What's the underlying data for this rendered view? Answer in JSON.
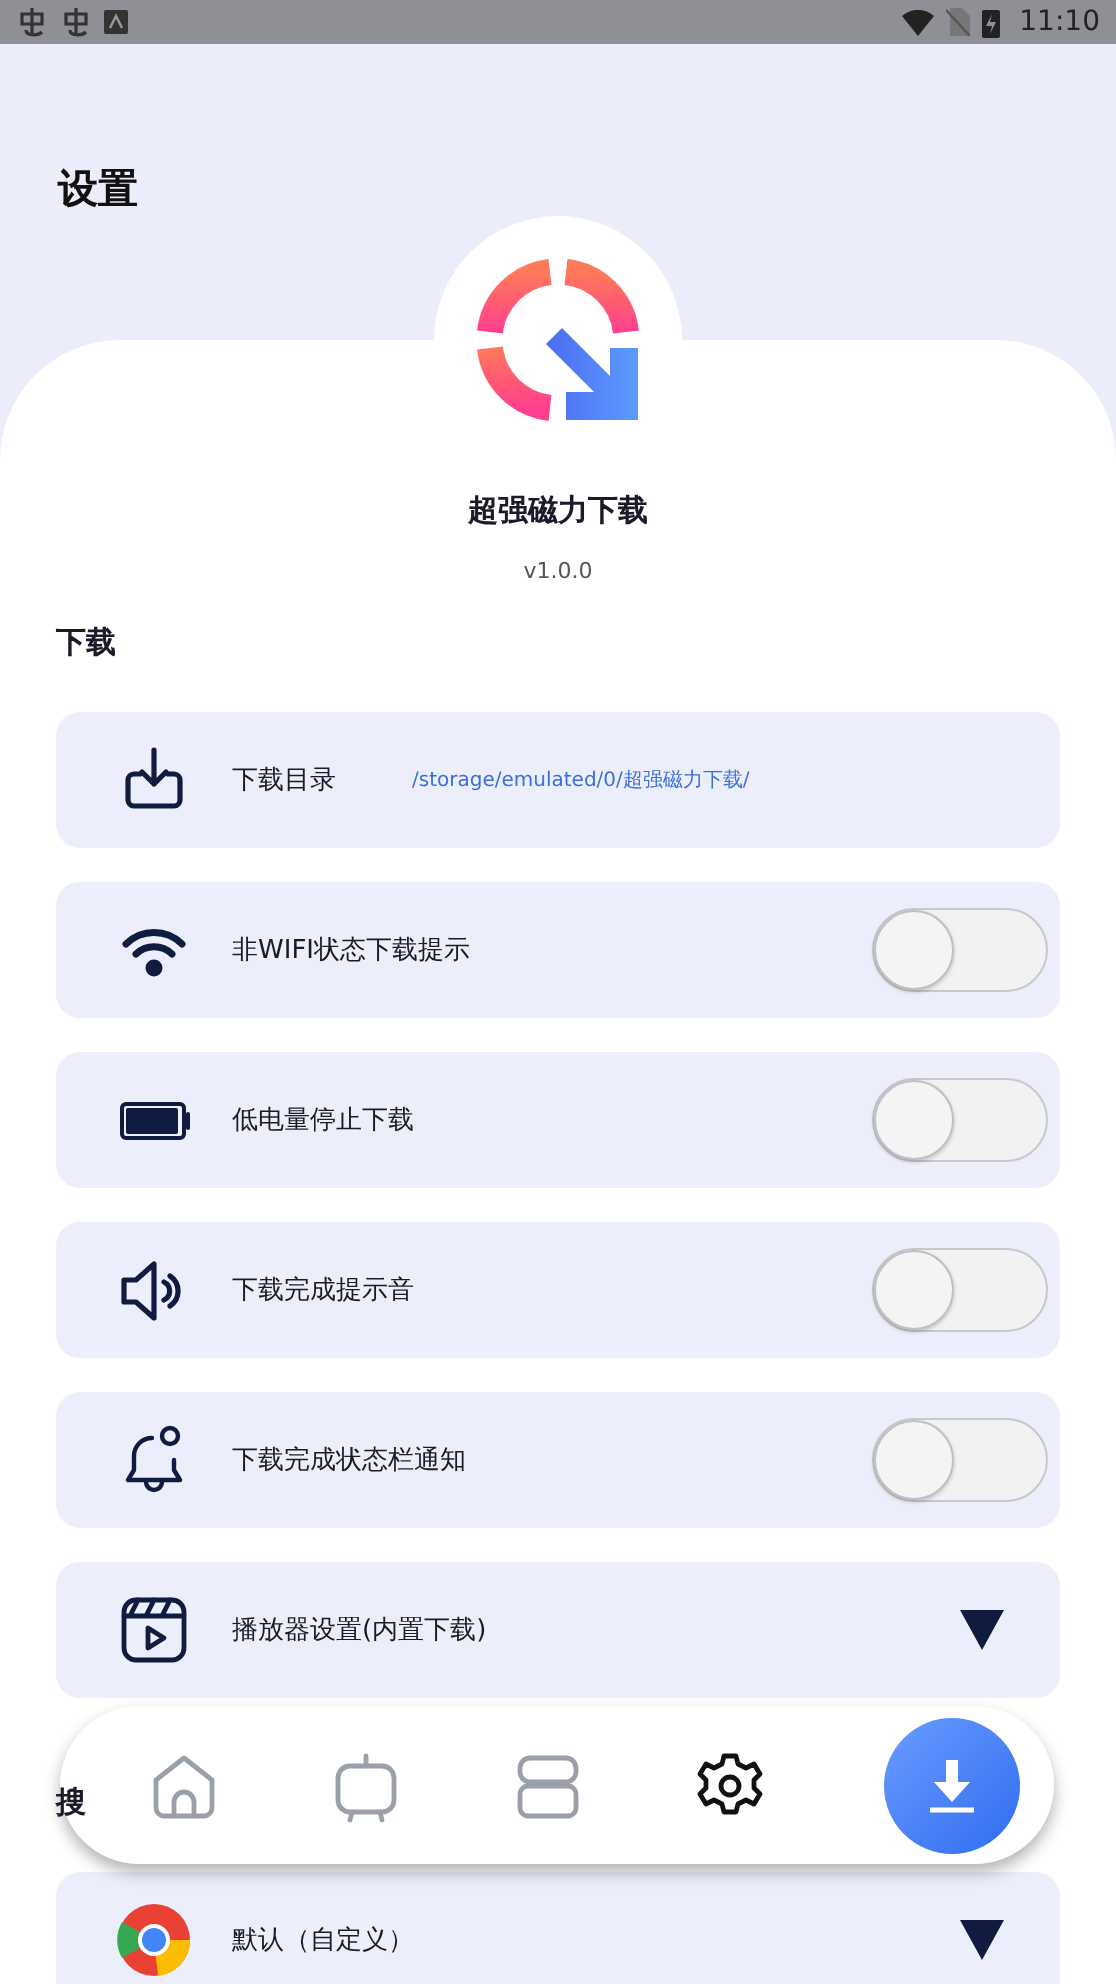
{
  "status_bar": {
    "time": "11:10"
  },
  "title": "设置",
  "app": {
    "name": "超强磁力下载",
    "version": "v1.0.0"
  },
  "sections": [
    {
      "title": "下载",
      "items": [
        {
          "kind": "path",
          "label": "下载目录",
          "value": "/storage/emulated/0/超强磁力下载/"
        },
        {
          "kind": "toggle",
          "label": "非WIFI状态下载提示",
          "on": false
        },
        {
          "kind": "toggle",
          "label": "低电量停止下载",
          "on": false
        },
        {
          "kind": "toggle",
          "label": "下载完成提示音",
          "on": false
        },
        {
          "kind": "toggle",
          "label": "下载完成状态栏通知",
          "on": false
        },
        {
          "kind": "dropdown",
          "label": "播放器设置(内置下载)"
        }
      ]
    },
    {
      "title": "搜",
      "items": [
        {
          "kind": "dropdown",
          "label": "默认（自定义）"
        }
      ]
    }
  ],
  "nav": [
    {
      "selected": false
    },
    {
      "selected": false
    },
    {
      "selected": false
    },
    {
      "selected": true
    }
  ]
}
